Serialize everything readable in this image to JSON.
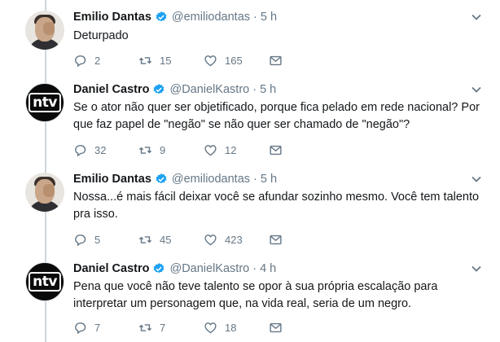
{
  "tweets": [
    {
      "name": "Emilio Dantas",
      "handle": "@emiliodantas",
      "dot": "·",
      "time": "5 h",
      "text": "Deturpado",
      "replies": "2",
      "retweets": "15",
      "likes": "165",
      "avatar": "photo"
    },
    {
      "name": "Daniel Castro",
      "handle": "@DanielKastro",
      "dot": "·",
      "time": "5 h",
      "text": "Se o ator não quer ser objetificado, porque fica pelado em rede nacional? Por que faz papel de \"negão\" se não quer ser chamado de \"negão\"?",
      "replies": "32",
      "retweets": "9",
      "likes": "12",
      "avatar": "logo",
      "logo_text": "ntv"
    },
    {
      "name": "Emilio Dantas",
      "handle": "@emiliodantas",
      "dot": "·",
      "time": "5 h",
      "text": "Nossa...é mais fácil deixar você se afundar sozinho mesmo. Você tem talento pra isso.",
      "replies": "5",
      "retweets": "45",
      "likes": "423",
      "avatar": "photo"
    },
    {
      "name": "Daniel Castro",
      "handle": "@DanielKastro",
      "dot": "·",
      "time": "4 h",
      "text": "Pena que você não teve talento se opor à sua própria escalação para interpretar um personagem que, na vida real, seria de um negro.",
      "replies": "7",
      "retweets": "7",
      "likes": "18",
      "avatar": "logo",
      "logo_text": "ntv"
    }
  ],
  "icons": {
    "reply": "reply-icon",
    "retweet": "retweet-icon",
    "like": "heart-icon",
    "dm": "envelope-icon",
    "verified": "verified-badge-icon",
    "more": "chevron-down-icon"
  },
  "colors": {
    "verified": "#1da1f2",
    "secondary": "#657786",
    "text": "#14171a",
    "thread_line": "#ccd6dd"
  }
}
